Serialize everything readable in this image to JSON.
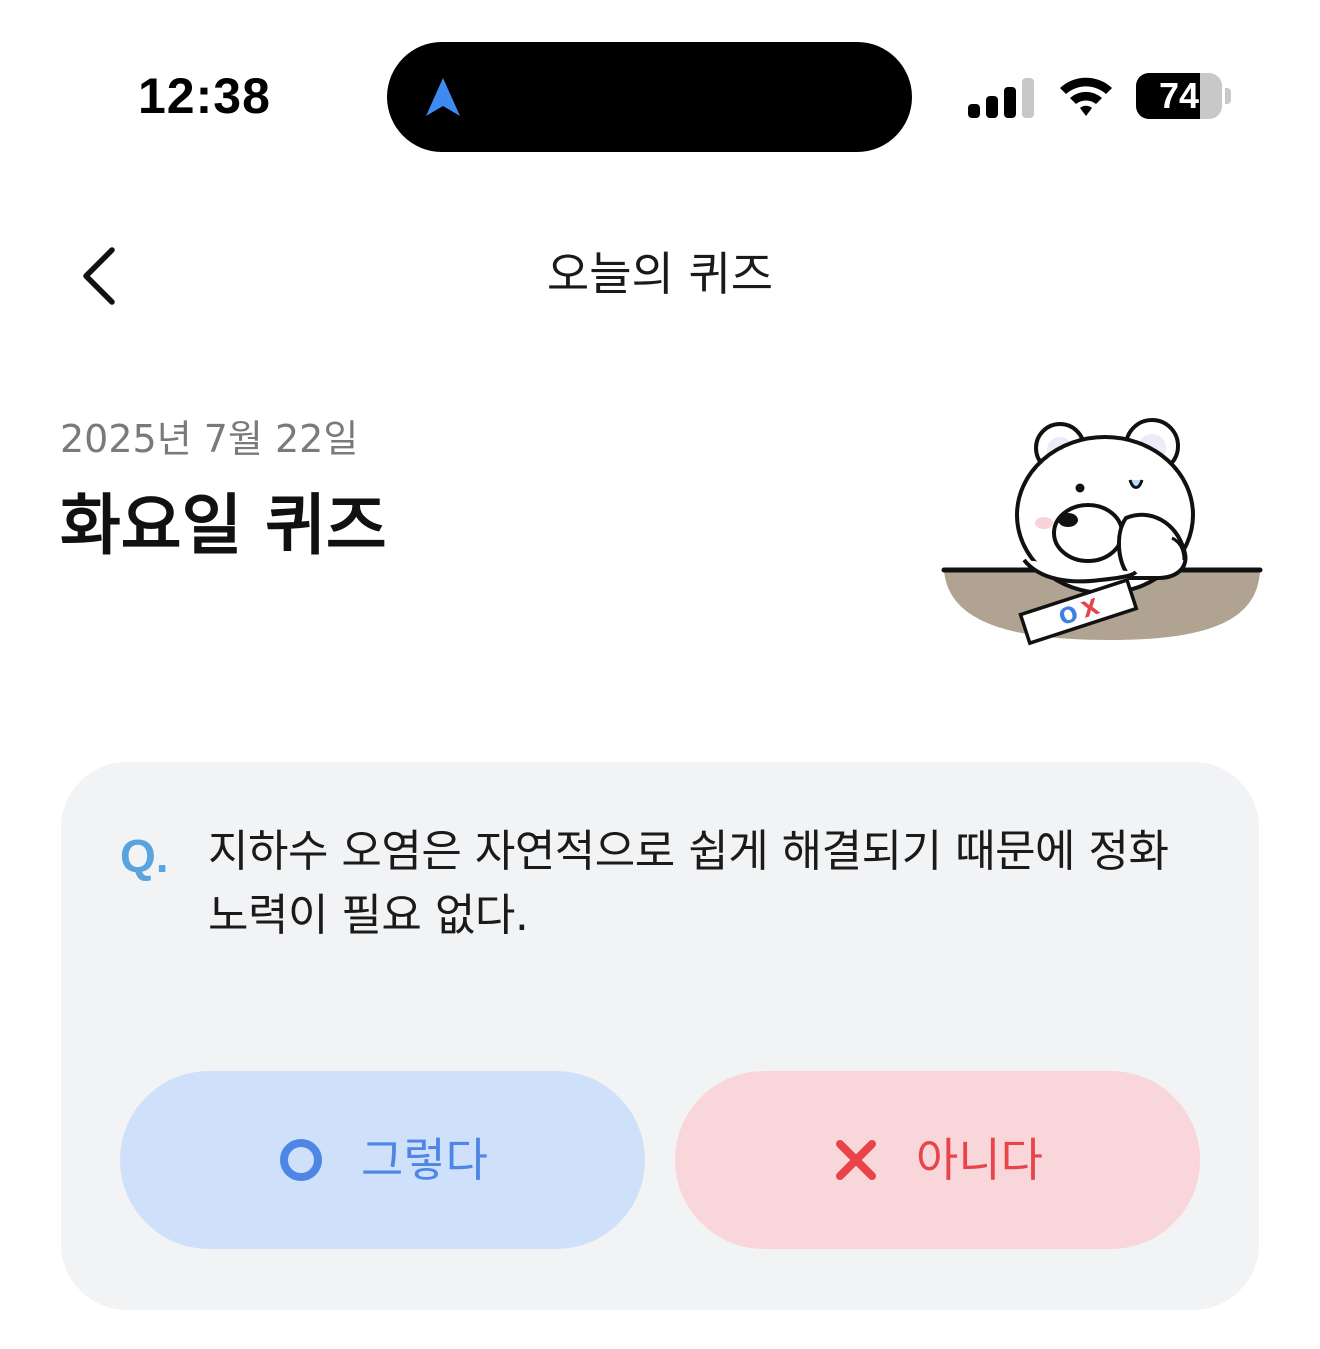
{
  "status_bar": {
    "time": "12:38",
    "battery_level": "74",
    "battery_fraction": 0.74,
    "signal_bars_active": 3,
    "signal_bars_total": 4
  },
  "header": {
    "title": "오늘의 퀴즈",
    "back_icon": "chevron-left-icon"
  },
  "hero": {
    "date": "2025년 7월 22일",
    "title": "화요일 퀴즈",
    "mascot_sheet_text": {
      "o": "O",
      "x": "X"
    }
  },
  "quiz": {
    "q_mark": "Q.",
    "question": "지하수 오염은 자연적으로 쉽게 해결되기 때문에 정화 노력이 필요 없다.",
    "options": [
      {
        "label": "그렇다",
        "icon": "circle-o-icon"
      },
      {
        "label": "아니다",
        "icon": "x-cross-icon"
      }
    ]
  },
  "colors": {
    "yes_bg": "#cfe0fb",
    "yes_fg": "#4d86e4",
    "no_bg": "#f8d6d9",
    "no_fg": "#e8444a",
    "card_bg": "#f2f3f5",
    "q_mark": "#5aa3dd",
    "nav_arrow": "#3d8bf2"
  }
}
